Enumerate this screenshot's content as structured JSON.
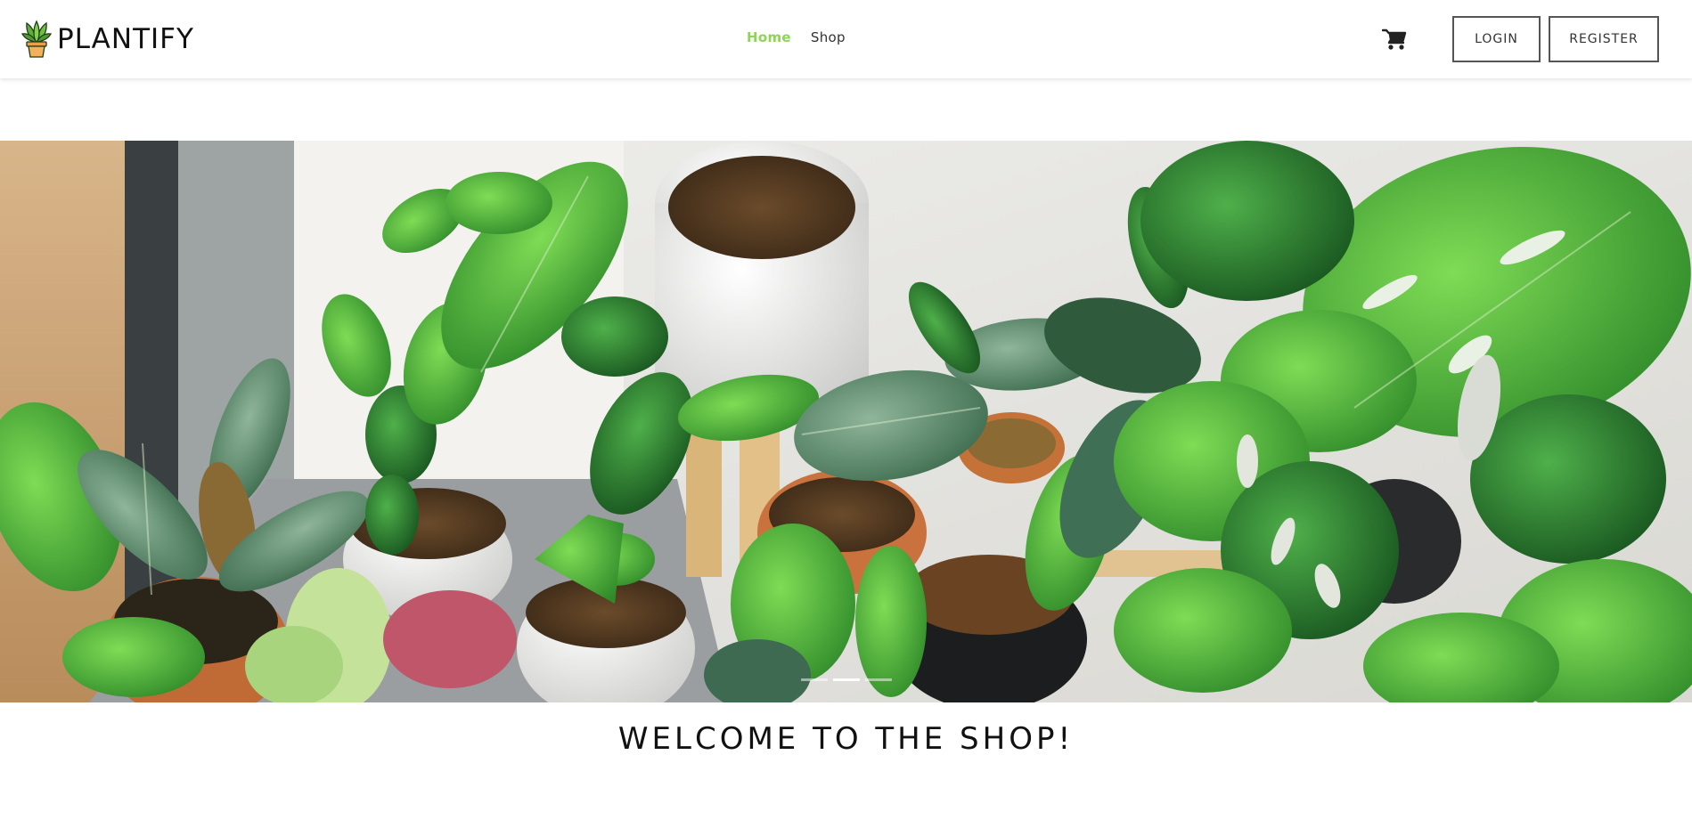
{
  "brand": {
    "name": "PLANTIFY",
    "logo_icon": "potted-plant-icon"
  },
  "nav": {
    "links": [
      {
        "label": "Home",
        "active": true
      },
      {
        "label": "Shop",
        "active": false
      }
    ]
  },
  "header": {
    "cart_icon": "shopping-cart-icon",
    "login_label": "LOGIN",
    "register_label": "REGISTER"
  },
  "hero": {
    "image_subject": "potted houseplants",
    "slide_count": 3,
    "active_slide": 2
  },
  "main": {
    "welcome_title": "WELCOME TO THE SHOP!"
  },
  "colors": {
    "accent": "#8ed455",
    "text": "#111111",
    "border": "#555555"
  }
}
